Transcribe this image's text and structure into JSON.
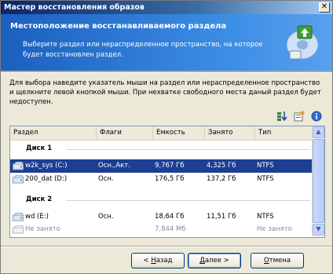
{
  "window": {
    "title": "Мастер восстановления образов"
  },
  "header": {
    "title": "Местоположение восстанавливаемого раздела",
    "subtitle": "Выберите раздел или нераспределенное пространство, на которое будет восстановлен раздел."
  },
  "instructions": "Для выбора наведите указатель мыши на раздел или нераспределенное пространство и щелкните левой кнопкой мыши. При нехватке свободного места даный раздел будет недоступен.",
  "toolbar": {
    "icons": [
      "sort-icon",
      "properties-icon",
      "info-icon"
    ]
  },
  "table": {
    "columns": [
      "Раздел",
      "Флаги",
      "Емкость",
      "Занято",
      "Тип"
    ],
    "groups": [
      {
        "name": "Диск 1",
        "rows": [
          {
            "partition": "w2k_sys (C:)",
            "flags": "Осн.,Акт.",
            "capacity": "9,767 Гб",
            "used": "4,325 Гб",
            "type": "NTFS",
            "selected": true
          },
          {
            "partition": "200_dat (D:)",
            "flags": "Осн.",
            "capacity": "176,5 Гб",
            "used": "137,2 Гб",
            "type": "NTFS"
          }
        ]
      },
      {
        "name": "Диск 2",
        "rows": [
          {
            "partition": "wd (E:)",
            "flags": "Осн.",
            "capacity": "18,64 Гб",
            "used": "11,51 Гб",
            "type": "NTFS"
          },
          {
            "partition": "Не занято",
            "flags": "",
            "capacity": "7,844 Мб",
            "used": "",
            "type": "Не занято",
            "disabled": true
          }
        ]
      }
    ]
  },
  "buttons": {
    "back": {
      "prefix": "< ",
      "accel": "Н",
      "rest": "азад"
    },
    "next": {
      "accel": "Д",
      "rest": "алее >"
    },
    "cancel": {
      "accel": "О",
      "rest": "тмена"
    }
  },
  "colors": {
    "selection": "#1c3f94",
    "header": "#2a75d8"
  }
}
